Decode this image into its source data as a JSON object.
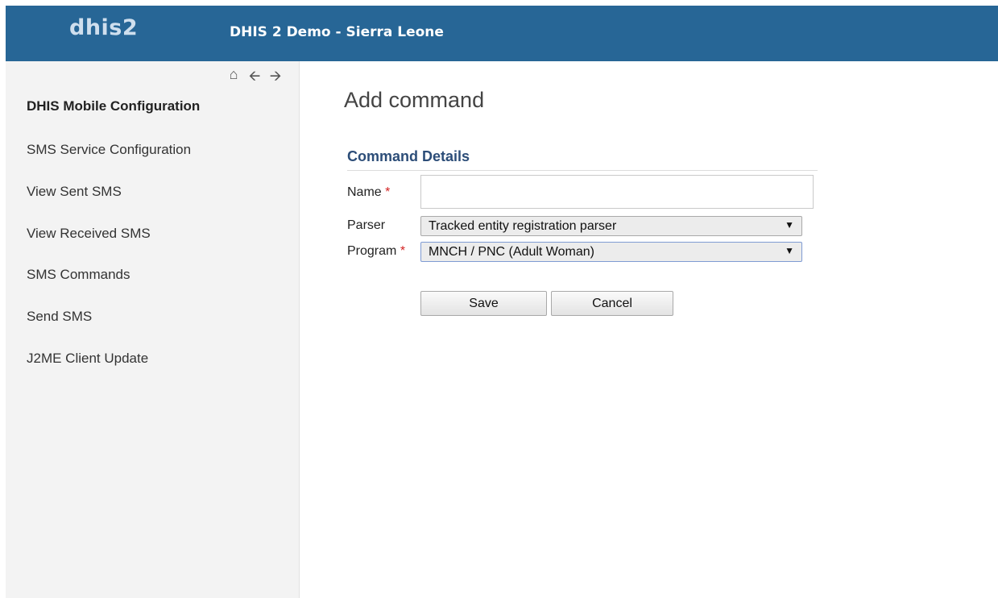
{
  "header": {
    "logo": "dhis2",
    "title": "DHIS 2 Demo - Sierra Leone"
  },
  "sidebar": {
    "nav_icons": [
      "home-icon",
      "arrow-left-icon",
      "arrow-right-icon"
    ],
    "items": [
      {
        "label": "DHIS Mobile Configuration",
        "active": true
      },
      {
        "label": "SMS Service Configuration",
        "active": false
      },
      {
        "label": "View Sent SMS",
        "active": false
      },
      {
        "label": "View Received SMS",
        "active": false
      },
      {
        "label": "SMS Commands",
        "active": false
      },
      {
        "label": "Send SMS",
        "active": false
      },
      {
        "label": "J2ME Client Update",
        "active": false
      }
    ]
  },
  "main": {
    "title": "Add command",
    "section_title": "Command Details",
    "form": {
      "name_label": "Name",
      "name_value": "",
      "parser_label": "Parser",
      "parser_value": "Tracked entity registration parser",
      "program_label": "Program",
      "program_value": "MNCH / PNC (Adult Woman)",
      "required_mark": "*"
    },
    "buttons": {
      "save": "Save",
      "cancel": "Cancel"
    }
  },
  "colors": {
    "header_bg": "#276696",
    "section_title": "#2c4d78",
    "required": "#d32323"
  }
}
